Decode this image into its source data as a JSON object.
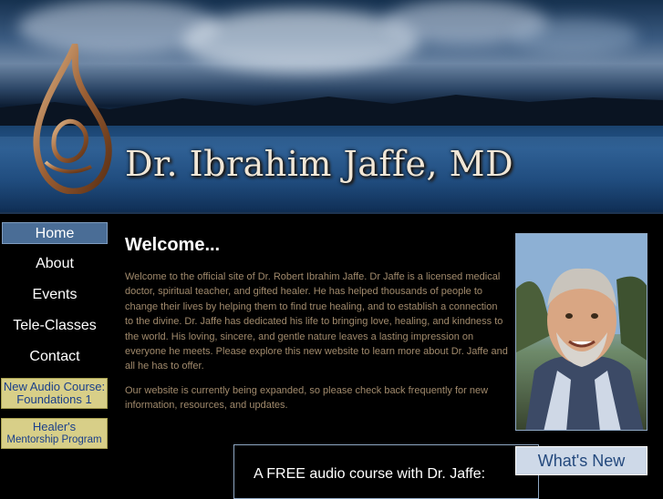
{
  "header": {
    "site_title": "Dr. Ibrahim Jaffe, MD"
  },
  "nav": {
    "items": [
      {
        "label": "Home",
        "active": true
      },
      {
        "label": "About"
      },
      {
        "label": "Events"
      },
      {
        "label": "Tele-Classes"
      },
      {
        "label": "Contact"
      }
    ],
    "promos": [
      {
        "line1": "New Audio Course:",
        "line2": "Foundations 1"
      },
      {
        "line1": "Healer's",
        "line2": "Mentorship Program"
      }
    ]
  },
  "main": {
    "heading": "Welcome...",
    "paragraphs": [
      "Welcome to the official site of Dr. Robert Ibrahim Jaffe. Dr Jaffe is a licensed medical doctor, spiritual teacher, and gifted healer. He has helped thousands of people to change their lives by helping them to find true healing, and to establish a connection to the divine. Dr. Jaffe has dedicated his life to bringing love, healing, and kindness to the world. His loving, sincere, and gentle nature leaves a lasting impression on everyone he meets. Please explore this new website to learn more about Dr. Jaffe and all he has to offer.",
      "Our website is currently being expanded, so please check back frequently for new information, resources, and updates."
    ]
  },
  "sidebar": {
    "whats_new_label": "What's New"
  },
  "footer": {
    "audio_text": "A FREE audio course with Dr. Jaffe:"
  },
  "colors": {
    "nav_active": "#4a6d96",
    "promo_bg": "#d8cf88",
    "promo_text": "#1a3f8a",
    "body_text": "#a18a6c"
  }
}
